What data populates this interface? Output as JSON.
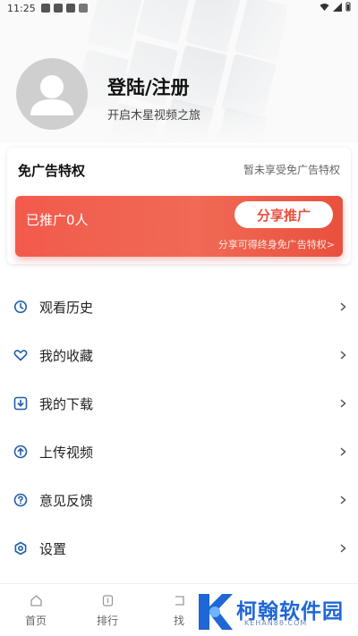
{
  "status_bar": {
    "time": "11:25"
  },
  "profile": {
    "title": "登陆/注册",
    "subtitle": "开启木星视频之旅"
  },
  "privilege": {
    "title": "免广告特权",
    "status": "暂未享受免广告特权",
    "promoted_count": "已推广0人",
    "share_button": "分享推广",
    "share_hint": "分享可得终身免广告特权>"
  },
  "menu": [
    {
      "label": "观看历史",
      "icon": "history-icon"
    },
    {
      "label": "我的收藏",
      "icon": "favorite-icon"
    },
    {
      "label": "我的下载",
      "icon": "download-icon"
    },
    {
      "label": "上传视频",
      "icon": "upload-icon"
    },
    {
      "label": "意见反馈",
      "icon": "feedback-icon"
    },
    {
      "label": "设置",
      "icon": "settings-icon"
    }
  ],
  "bottom_nav": [
    {
      "label": "首页",
      "icon": "home-icon"
    },
    {
      "label": "排行",
      "icon": "ranking-icon"
    },
    {
      "label": "找",
      "icon": "find-icon"
    }
  ],
  "watermark": {
    "text": "柯翰软件园",
    "domain": "KEHAN88.COM"
  },
  "colors": {
    "accent": "#e9503e",
    "watermark": "#1f66d6"
  }
}
